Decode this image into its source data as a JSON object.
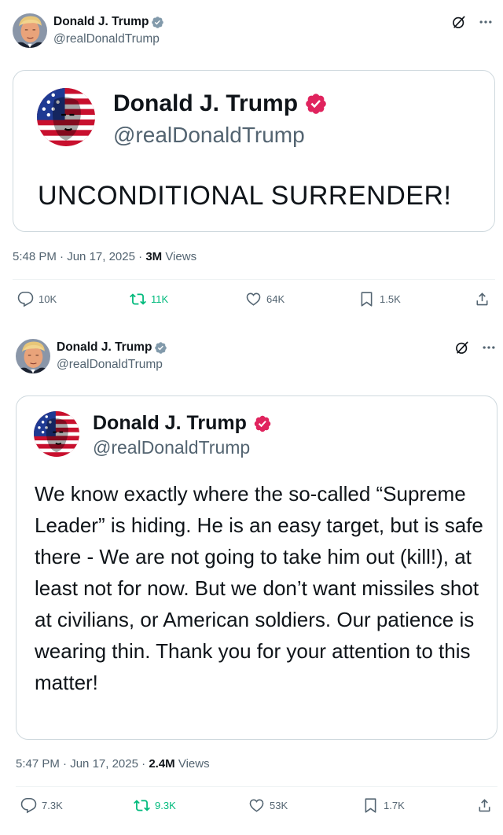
{
  "posts": [
    {
      "author": {
        "name": "Donald J. Trump",
        "handle": "@realDonaldTrump"
      },
      "card": {
        "name": "Donald J. Trump",
        "handle": "@realDonaldTrump",
        "text": "UNCONDITIONAL SURRENDER!"
      },
      "meta": {
        "time": "5:48 PM",
        "date": "Jun 17, 2025",
        "views_count": "3M",
        "views_label": "Views",
        "sep": "·"
      },
      "stats": {
        "replies": "10K",
        "reposts": "11K",
        "likes": "64K",
        "bookmarks": "1.5K"
      }
    },
    {
      "author": {
        "name": "Donald J. Trump",
        "handle": "@realDonaldTrump"
      },
      "card": {
        "name": "Donald J. Trump",
        "handle": "@realDonaldTrump",
        "text": "We know exactly where the so-called “Supreme Leader” is hiding. He is an easy target, but is safe there - We are not going to take him out (kill!), at least not for now. But we don’t want missiles shot at civilians, or American soldiers. Our patience is wearing thin. Thank you for your attention to this matter!"
      },
      "meta": {
        "time": "5:47 PM",
        "date": "Jun 17, 2025",
        "views_count": "2.4M",
        "views_label": "Views",
        "sep": "·"
      },
      "stats": {
        "replies": "7.3K",
        "reposts": "9.3K",
        "likes": "53K",
        "bookmarks": "1.7K"
      }
    }
  ],
  "icons": {
    "verified_header": "verified-badge-blue",
    "verified_card": "verified-badge-red",
    "grok": "grok-icon",
    "more": "more-icon",
    "reply": "reply-icon",
    "repost": "repost-icon",
    "like": "like-icon",
    "bookmark": "bookmark-icon",
    "share": "share-icon"
  },
  "colors": {
    "text": "#0f1419",
    "secondary": "#536471",
    "verified_blue": "#829aab",
    "verified_red": "#e0245e",
    "repost_green": "#00ba7c",
    "border": "#cfd9de"
  }
}
